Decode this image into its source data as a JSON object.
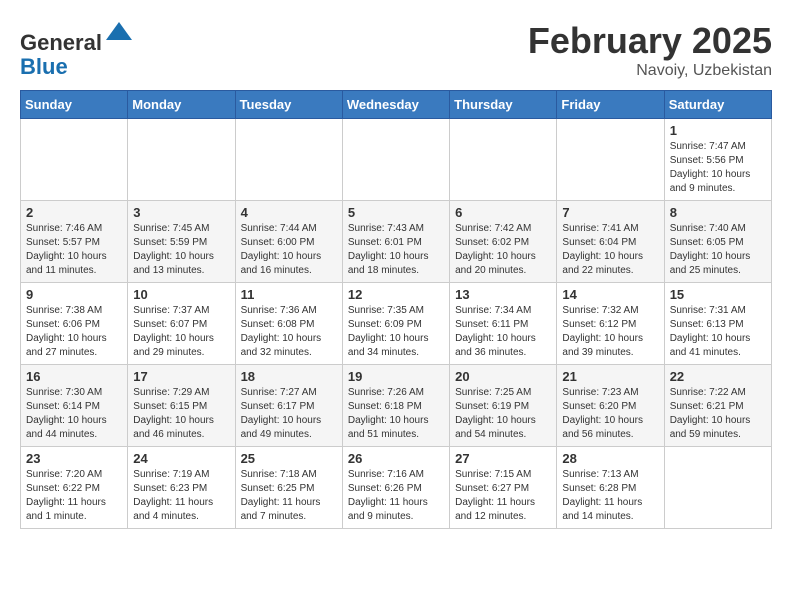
{
  "header": {
    "logo_line1": "General",
    "logo_line2": "Blue",
    "month_title": "February 2025",
    "location": "Navoiy, Uzbekistan"
  },
  "weekdays": [
    "Sunday",
    "Monday",
    "Tuesday",
    "Wednesday",
    "Thursday",
    "Friday",
    "Saturday"
  ],
  "weeks": [
    [
      {
        "day": null,
        "info": null
      },
      {
        "day": null,
        "info": null
      },
      {
        "day": null,
        "info": null
      },
      {
        "day": null,
        "info": null
      },
      {
        "day": null,
        "info": null
      },
      {
        "day": null,
        "info": null
      },
      {
        "day": "1",
        "info": "Sunrise: 7:47 AM\nSunset: 5:56 PM\nDaylight: 10 hours\nand 9 minutes."
      }
    ],
    [
      {
        "day": "2",
        "info": "Sunrise: 7:46 AM\nSunset: 5:57 PM\nDaylight: 10 hours\nand 11 minutes."
      },
      {
        "day": "3",
        "info": "Sunrise: 7:45 AM\nSunset: 5:59 PM\nDaylight: 10 hours\nand 13 minutes."
      },
      {
        "day": "4",
        "info": "Sunrise: 7:44 AM\nSunset: 6:00 PM\nDaylight: 10 hours\nand 16 minutes."
      },
      {
        "day": "5",
        "info": "Sunrise: 7:43 AM\nSunset: 6:01 PM\nDaylight: 10 hours\nand 18 minutes."
      },
      {
        "day": "6",
        "info": "Sunrise: 7:42 AM\nSunset: 6:02 PM\nDaylight: 10 hours\nand 20 minutes."
      },
      {
        "day": "7",
        "info": "Sunrise: 7:41 AM\nSunset: 6:04 PM\nDaylight: 10 hours\nand 22 minutes."
      },
      {
        "day": "8",
        "info": "Sunrise: 7:40 AM\nSunset: 6:05 PM\nDaylight: 10 hours\nand 25 minutes."
      }
    ],
    [
      {
        "day": "9",
        "info": "Sunrise: 7:38 AM\nSunset: 6:06 PM\nDaylight: 10 hours\nand 27 minutes."
      },
      {
        "day": "10",
        "info": "Sunrise: 7:37 AM\nSunset: 6:07 PM\nDaylight: 10 hours\nand 29 minutes."
      },
      {
        "day": "11",
        "info": "Sunrise: 7:36 AM\nSunset: 6:08 PM\nDaylight: 10 hours\nand 32 minutes."
      },
      {
        "day": "12",
        "info": "Sunrise: 7:35 AM\nSunset: 6:09 PM\nDaylight: 10 hours\nand 34 minutes."
      },
      {
        "day": "13",
        "info": "Sunrise: 7:34 AM\nSunset: 6:11 PM\nDaylight: 10 hours\nand 36 minutes."
      },
      {
        "day": "14",
        "info": "Sunrise: 7:32 AM\nSunset: 6:12 PM\nDaylight: 10 hours\nand 39 minutes."
      },
      {
        "day": "15",
        "info": "Sunrise: 7:31 AM\nSunset: 6:13 PM\nDaylight: 10 hours\nand 41 minutes."
      }
    ],
    [
      {
        "day": "16",
        "info": "Sunrise: 7:30 AM\nSunset: 6:14 PM\nDaylight: 10 hours\nand 44 minutes."
      },
      {
        "day": "17",
        "info": "Sunrise: 7:29 AM\nSunset: 6:15 PM\nDaylight: 10 hours\nand 46 minutes."
      },
      {
        "day": "18",
        "info": "Sunrise: 7:27 AM\nSunset: 6:17 PM\nDaylight: 10 hours\nand 49 minutes."
      },
      {
        "day": "19",
        "info": "Sunrise: 7:26 AM\nSunset: 6:18 PM\nDaylight: 10 hours\nand 51 minutes."
      },
      {
        "day": "20",
        "info": "Sunrise: 7:25 AM\nSunset: 6:19 PM\nDaylight: 10 hours\nand 54 minutes."
      },
      {
        "day": "21",
        "info": "Sunrise: 7:23 AM\nSunset: 6:20 PM\nDaylight: 10 hours\nand 56 minutes."
      },
      {
        "day": "22",
        "info": "Sunrise: 7:22 AM\nSunset: 6:21 PM\nDaylight: 10 hours\nand 59 minutes."
      }
    ],
    [
      {
        "day": "23",
        "info": "Sunrise: 7:20 AM\nSunset: 6:22 PM\nDaylight: 11 hours\nand 1 minute."
      },
      {
        "day": "24",
        "info": "Sunrise: 7:19 AM\nSunset: 6:23 PM\nDaylight: 11 hours\nand 4 minutes."
      },
      {
        "day": "25",
        "info": "Sunrise: 7:18 AM\nSunset: 6:25 PM\nDaylight: 11 hours\nand 7 minutes."
      },
      {
        "day": "26",
        "info": "Sunrise: 7:16 AM\nSunset: 6:26 PM\nDaylight: 11 hours\nand 9 minutes."
      },
      {
        "day": "27",
        "info": "Sunrise: 7:15 AM\nSunset: 6:27 PM\nDaylight: 11 hours\nand 12 minutes."
      },
      {
        "day": "28",
        "info": "Sunrise: 7:13 AM\nSunset: 6:28 PM\nDaylight: 11 hours\nand 14 minutes."
      },
      {
        "day": null,
        "info": null
      }
    ]
  ]
}
